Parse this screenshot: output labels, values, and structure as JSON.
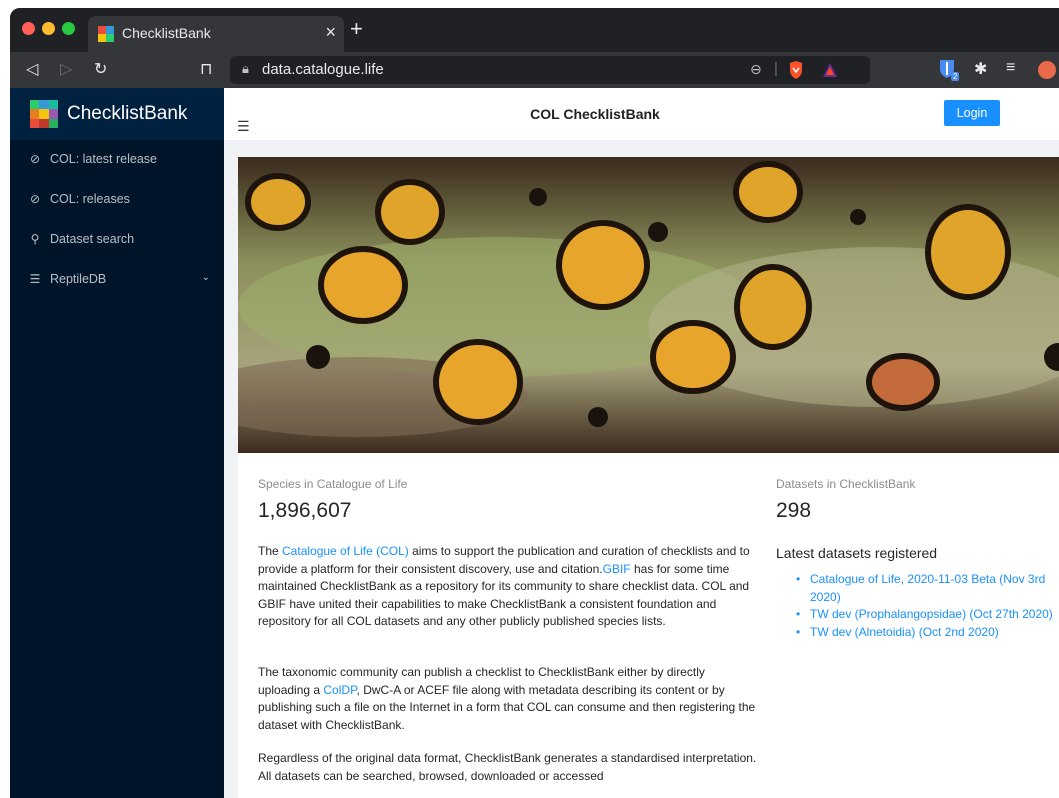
{
  "browser": {
    "tab_title": "ChecklistBank",
    "tab_close": "×",
    "new_tab": "+",
    "url": "data.catalogue.life",
    "extension_badge": "2"
  },
  "sidebar": {
    "brand": "ChecklistBank",
    "items": [
      {
        "label": "COL: latest release",
        "icon": "tag-icon"
      },
      {
        "label": "COL: releases",
        "icon": "tags-icon"
      },
      {
        "label": "Dataset search",
        "icon": "search-icon"
      },
      {
        "label": "ReptileDB",
        "icon": "list-icon"
      }
    ]
  },
  "header": {
    "title": "COL ChecklistBank",
    "login": "Login"
  },
  "stats": {
    "species_label": "Species in Catalogue of Life",
    "species_value": "1,896,607",
    "datasets_label": "Datasets in ChecklistBank",
    "datasets_value": "298"
  },
  "intro": {
    "p1_pre": "The ",
    "p1_link1": "Catalogue of Life (COL)",
    "p1_mid": " aims to support the publication and curation of checklists and to provide a platform for their consistent discovery, use and citation.",
    "p1_link2": "GBIF",
    "p1_post": " has for some time maintained ChecklistBank as a repository for its community to share checklist data. COL and GBIF have united their capabilities to make ChecklistBank a consistent foundation and repository for all COL datasets and any other publicly published species lists.",
    "p2_pre": "The taxonomic community can publish a checklist to ChecklistBank either by directly uploading a ",
    "p2_link": "ColDP",
    "p2_post": ", DwC-A or ACEF file along with metadata describing its content or by publishing such a file on the Internet in a form that COL can consume and then registering the dataset with ChecklistBank.",
    "p3": "Regardless of the original data format, ChecklistBank generates a standardised interpretation. All datasets can be searched, browsed, downloaded or accessed"
  },
  "latest": {
    "heading": "Latest datasets registered",
    "items": [
      "Catalogue of Life, 2020-11-03 Beta (Nov 3rd 2020)",
      "TW dev (Prophalangopsidae) (Oct 27th 2020)",
      "TW dev (Alnetoidia) (Oct 2nd 2020)"
    ]
  },
  "colors": {
    "sider": "#001529",
    "accent": "#1890ff"
  }
}
